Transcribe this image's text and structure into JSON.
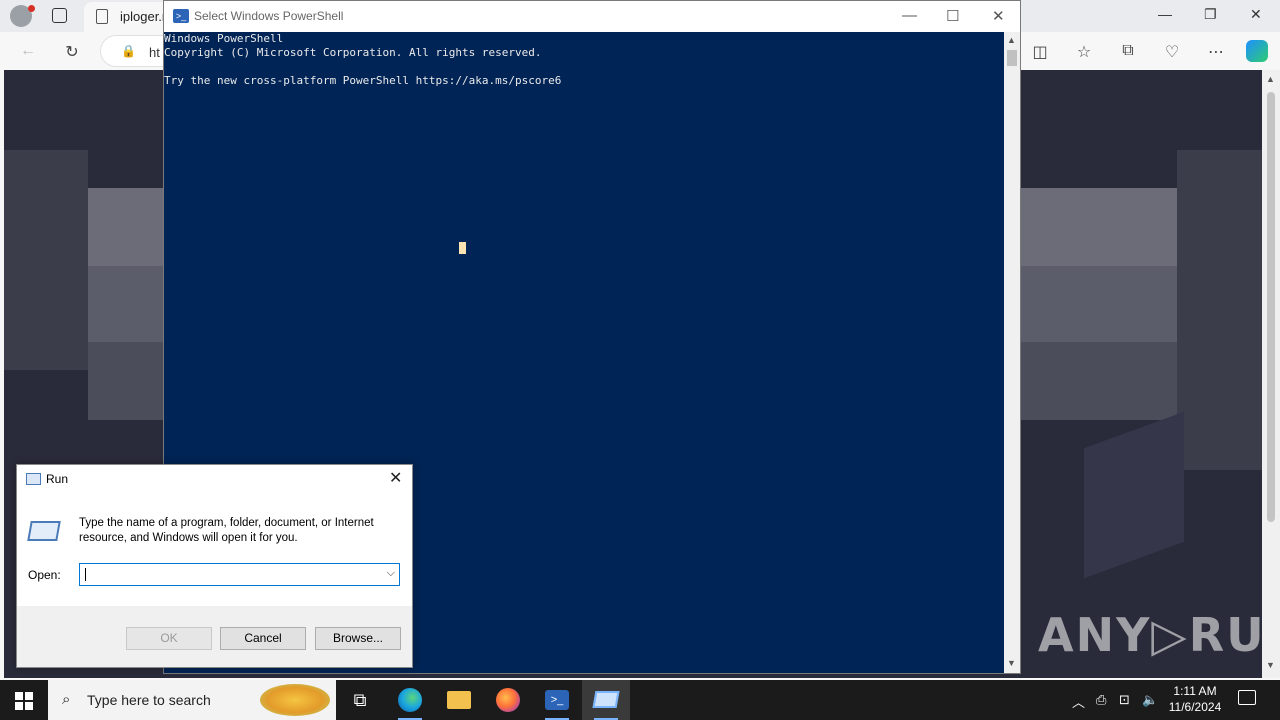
{
  "browser": {
    "tab_title": "iploger.r",
    "address_prefix": "ht"
  },
  "powershell": {
    "window_title": "Select Windows PowerShell",
    "lines": [
      "Windows PowerShell",
      "Copyright (C) Microsoft Corporation. All rights reserved.",
      "",
      "Try the new cross-platform PowerShell https://aka.ms/pscore6"
    ],
    "body_bg": "#012456"
  },
  "run_dialog": {
    "title": "Run",
    "description": "Type the name of a program, folder, document, or Internet resource, and Windows will open it for you.",
    "open_label": "Open:",
    "open_value": "",
    "ok_label": "OK",
    "cancel_label": "Cancel",
    "browse_label": "Browse..."
  },
  "watermark": "ANY▷RUN",
  "taskbar": {
    "search_placeholder": "Type here to search",
    "time": "1:11 AM",
    "date": "11/6/2024",
    "apps": [
      "task-view",
      "edge",
      "file-explorer",
      "firefox",
      "powershell",
      "run"
    ]
  }
}
